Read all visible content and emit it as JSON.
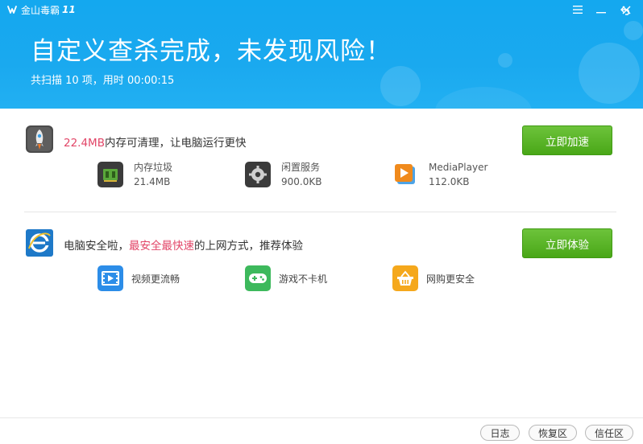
{
  "app": {
    "name": "金山毒霸",
    "version": "11"
  },
  "window_controls": [
    {
      "name": "menu-icon"
    },
    {
      "name": "minimize-icon"
    },
    {
      "name": "close-icon"
    },
    {
      "name": "back-icon"
    }
  ],
  "header": {
    "title": "自定义查杀完成，未发现风险！",
    "summary": "共扫描 10 项，用时 00:00:15"
  },
  "speedup": {
    "highlight": "22.4MB",
    "text": "内存可清理，让电脑运行更快",
    "button": "立即加速",
    "items": [
      {
        "label": "内存垃圾",
        "value": "21.4MB",
        "icon": "memory-chip-icon"
      },
      {
        "label": "闲置服务",
        "value": "900.0KB",
        "icon": "gear-icon"
      },
      {
        "label": "MediaPlayer",
        "value": "112.0KB",
        "icon": "media-player-icon"
      }
    ]
  },
  "browser": {
    "prefix": "电脑安全啦，",
    "highlight": "最安全最快速",
    "suffix": "的上网方式，推荐体验",
    "button": "立即体验",
    "items": [
      {
        "label": "视频更流畅",
        "icon": "video-film-icon",
        "color": "#2c8de8"
      },
      {
        "label": "游戏不卡机",
        "icon": "gamepad-icon",
        "color": "#3db95c"
      },
      {
        "label": "网购更安全",
        "icon": "shopping-basket-icon",
        "color": "#f5a81c"
      }
    ]
  },
  "footer": {
    "buttons": [
      "日志",
      "恢复区",
      "信任区"
    ]
  },
  "colors": {
    "header_blue": "#18a9ef",
    "highlight_pink": "#e24668",
    "button_green": "#52ad1f"
  }
}
